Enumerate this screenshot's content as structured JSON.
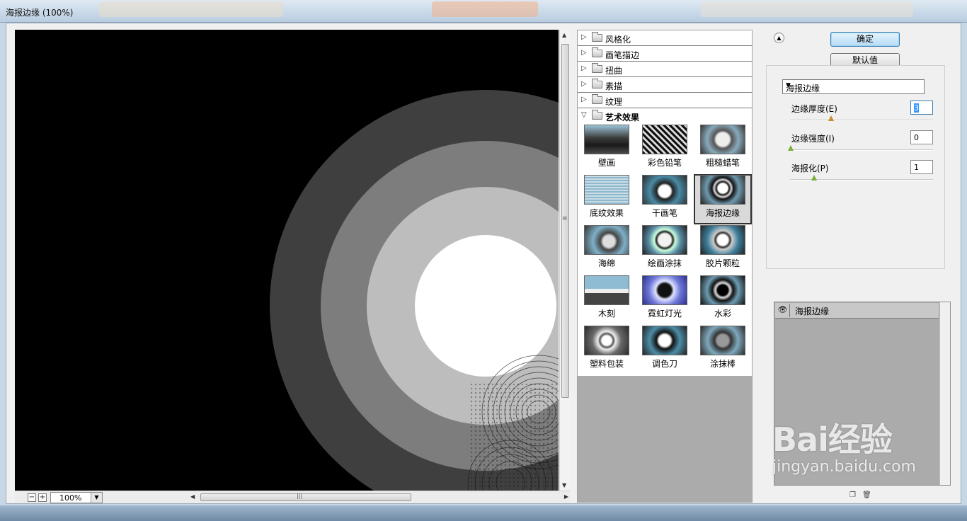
{
  "window": {
    "title": "海报边缘 (100%)"
  },
  "preview": {
    "zoom": "100%"
  },
  "gallery": {
    "categories": [
      {
        "label": "风格化",
        "expanded": false
      },
      {
        "label": "画笔描边",
        "expanded": false
      },
      {
        "label": "扭曲",
        "expanded": false
      },
      {
        "label": "素描",
        "expanded": false
      },
      {
        "label": "纹理",
        "expanded": false
      },
      {
        "label": "艺术效果",
        "expanded": true
      }
    ],
    "filters": [
      "壁画",
      "彩色铅笔",
      "粗糙蜡笔",
      "底纹效果",
      "干画笔",
      "海报边缘",
      "海绵",
      "绘画涂抹",
      "胶片颗粒",
      "木刻",
      "霓虹灯光",
      "水彩",
      "塑料包装",
      "调色刀",
      "涂抹棒"
    ],
    "selected_filter": "海报边缘"
  },
  "buttons": {
    "ok": "确定",
    "default": "默认值"
  },
  "settings": {
    "filter_select": "海报边缘",
    "params": [
      {
        "label": "边缘厚度(E)",
        "value": "3",
        "slider": 0.29
      },
      {
        "label": "边缘强度(I)",
        "value": "0",
        "slider": 0.0
      },
      {
        "label": "海报化(P)",
        "value": "1",
        "slider": 0.17
      }
    ]
  },
  "layers": {
    "items": [
      "海报边缘"
    ]
  },
  "watermark": {
    "brand": "Bai经验",
    "url": "jingyan.baidu.com"
  }
}
